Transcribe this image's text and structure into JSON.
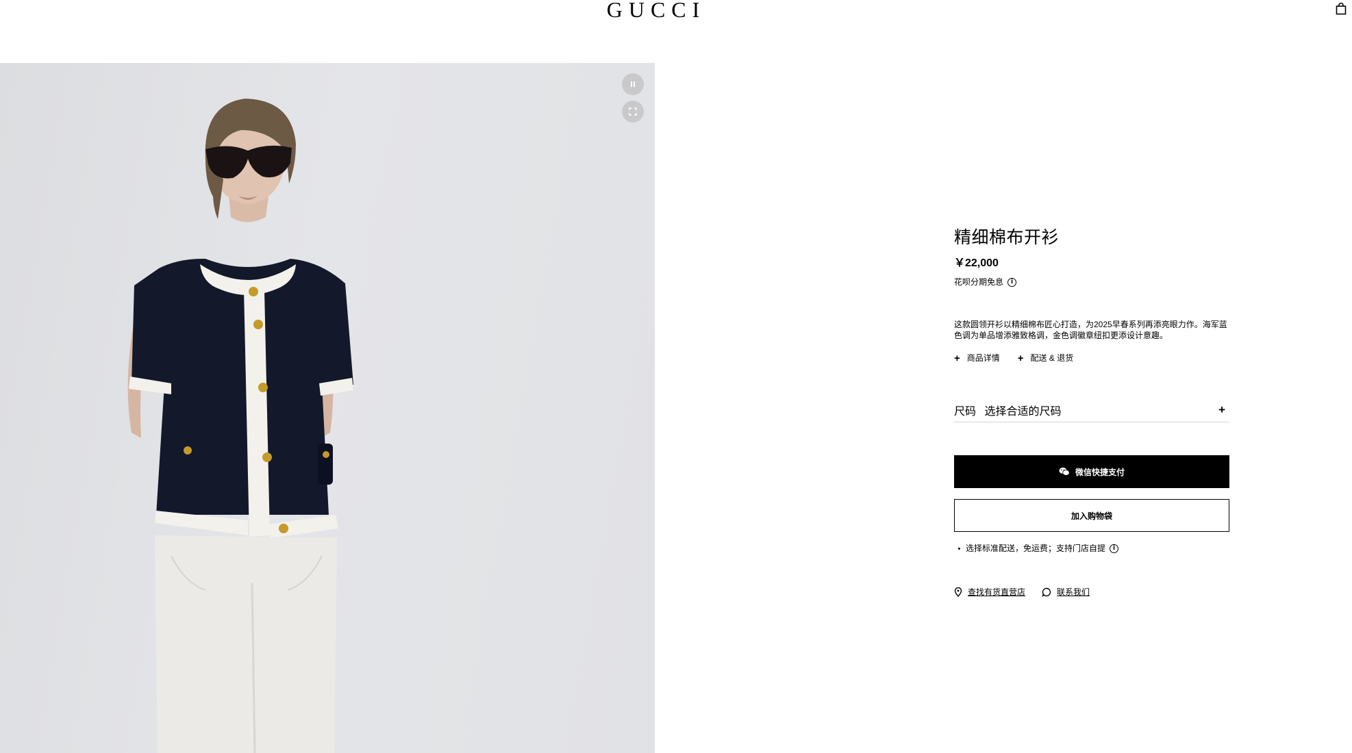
{
  "header": {
    "logo": "GUCCI",
    "bag_icon": "shopping-bag-icon"
  },
  "media": {
    "pause_icon": "pause-icon",
    "fullscreen_icon": "fullscreen-icon"
  },
  "product": {
    "title": "精细棉布开衫",
    "price": "￥22,000",
    "installment": "花呗分期免息",
    "description": "这款圆领开衫以精细棉布匠心打造，为2025早春系列再添亮眼力作。海军蓝色调为单品增添雅致格调，金色调徽章纽扣更添设计意趣。",
    "links": [
      {
        "label": "商品详情"
      },
      {
        "label": "配送 & 退货"
      }
    ],
    "size": {
      "label": "尺码",
      "placeholder": "选择合适的尺码"
    },
    "wechat_button": "微信快捷支付",
    "add_to_bag_button": "加入购物袋",
    "shipping_note": "选择标准配送，免运费；支持门店自提",
    "store_link": "查找有货直营店",
    "contact_link": "联系我们"
  },
  "colors": {
    "primary": "#000000",
    "background": "#ffffff",
    "media_bg": "#e2e3e6",
    "cardigan_navy": "#13182a",
    "trim_cream": "#f3f1ec",
    "button_gold": "#c49a2a"
  }
}
